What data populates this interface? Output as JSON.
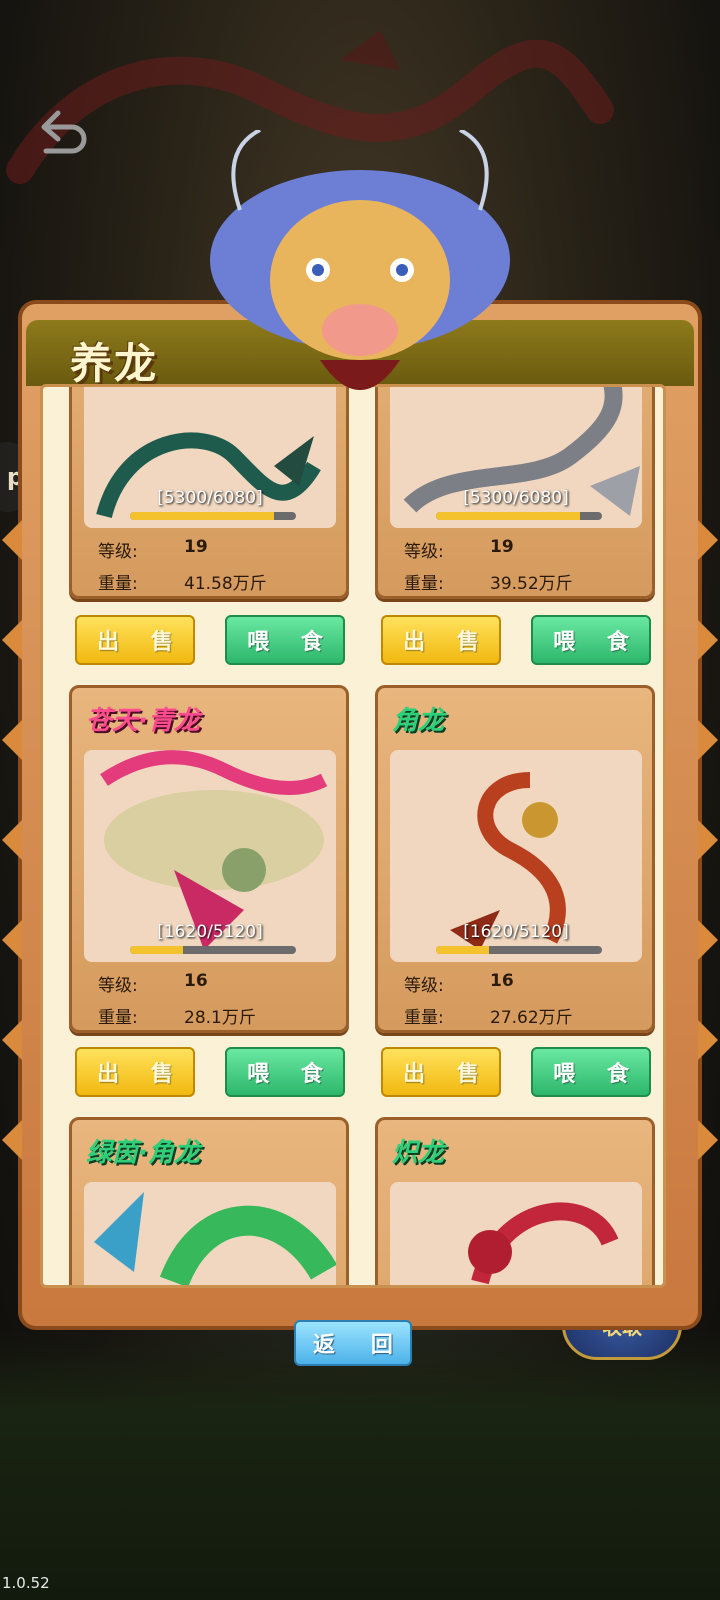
{
  "version": "1.0.52",
  "side_tab_text": "p",
  "collect_badge_text": "收取",
  "panel": {
    "title": "养龙"
  },
  "return_label": "返 回",
  "cards": [
    {
      "name": "",
      "progress": "[5300/6080]",
      "progress_value": 0.87,
      "level_label": "等级:",
      "level": "19",
      "weight_label": "重量:",
      "weight": "41.58万斤",
      "sell": "出 售",
      "feed": "喂 食"
    },
    {
      "name": "",
      "progress": "[5300/6080]",
      "progress_value": 0.87,
      "level_label": "等级:",
      "level": "19",
      "weight_label": "重量:",
      "weight": "39.52万斤",
      "sell": "出 售",
      "feed": "喂 食"
    },
    {
      "name": "苍天·青龙",
      "progress": "[1620/5120]",
      "progress_value": 0.32,
      "level_label": "等级:",
      "level": "16",
      "weight_label": "重量:",
      "weight": "28.1万斤",
      "sell": "出 售",
      "feed": "喂 食"
    },
    {
      "name": "角龙",
      "progress": "[1620/5120]",
      "progress_value": 0.32,
      "level_label": "等级:",
      "level": "16",
      "weight_label": "重量:",
      "weight": "27.62万斤",
      "sell": "出 售",
      "feed": "喂 食"
    },
    {
      "name": "绿茵·角龙"
    },
    {
      "name": "炽龙"
    }
  ],
  "colors": {
    "sell_button": "#f1b80f",
    "feed_button": "#2db76b",
    "progress_fill": "#f3c22c",
    "header": "#7a6a14"
  }
}
